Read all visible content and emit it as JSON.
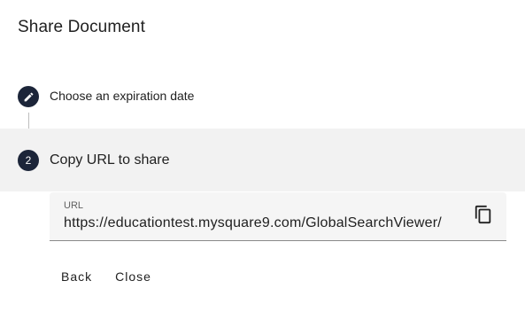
{
  "dialog": {
    "title": "Share Document"
  },
  "steps": [
    {
      "marker_icon": "pencil-icon",
      "label": "Choose an expiration date",
      "state": "completed"
    },
    {
      "marker_number": "2",
      "label": "Copy URL to share",
      "state": "active"
    }
  ],
  "url_field": {
    "label": "URL",
    "value": "https://educationtest.mysquare9.com/GlobalSearchViewer/",
    "copy_icon": "copy-icon"
  },
  "actions": {
    "back_label": "Back",
    "close_label": "Close"
  },
  "colors": {
    "step_icon_bg": "#1c2539",
    "active_step_bg": "#f2f2f2",
    "field_bg": "#f5f5f5"
  }
}
